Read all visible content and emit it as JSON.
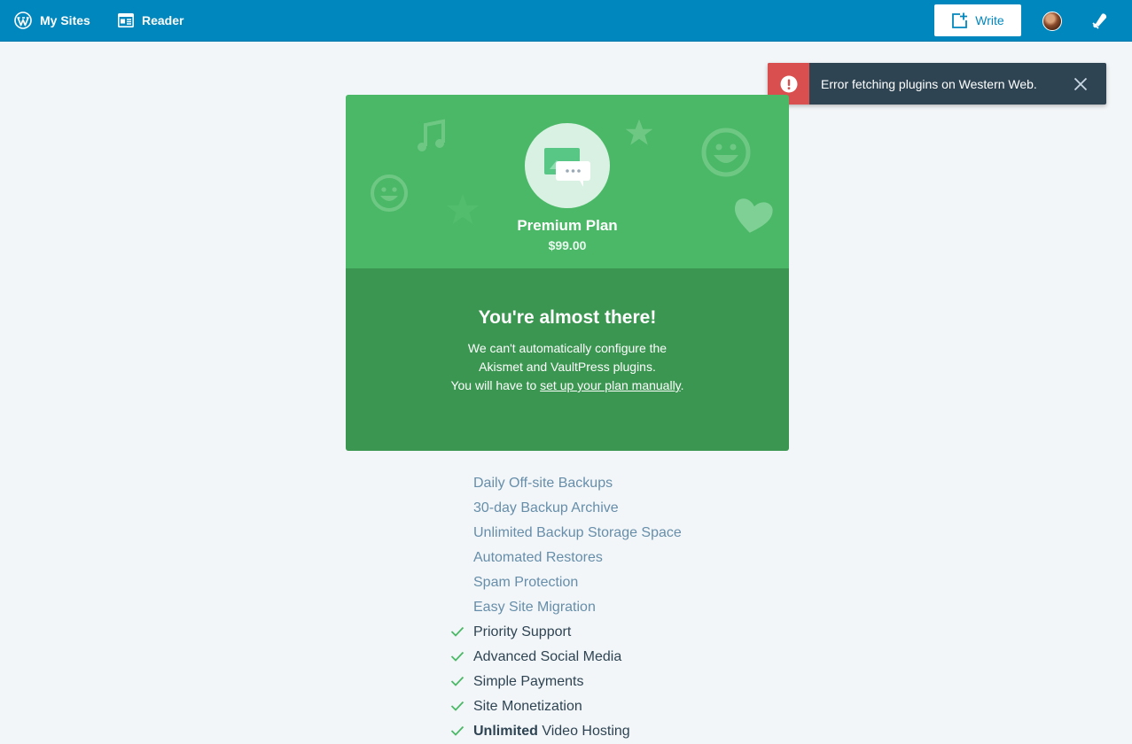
{
  "masterbar": {
    "my_sites": "My Sites",
    "reader": "Reader",
    "write": "Write"
  },
  "notice": {
    "status": "error",
    "text": "Error fetching plugins on Western Web.",
    "color": "#d94f4f"
  },
  "plan": {
    "name": "Premium Plan",
    "price": "$99.00",
    "accent": "#4ab866",
    "accent_dark": "#3a9650"
  },
  "message": {
    "title": "You're almost there!",
    "line1": "We can't automatically configure the",
    "line2": "Akismet and VaultPress plugins.",
    "line3_prefix": "You will have to ",
    "line3_link": "set up your plan manually",
    "line3_suffix": "."
  },
  "features": {
    "f1": "Daily Off-site Backups",
    "f2": "30-day Backup Archive",
    "f3": "Unlimited Backup Storage Space",
    "f4": "Automated Restores",
    "f5": "Spam Protection",
    "f6": "Easy Site Migration",
    "f7": "Priority Support",
    "f8": "Advanced Social Media",
    "f9": "Simple Payments",
    "f10": "Site Monetization",
    "f11_bold": "Unlimited",
    "f11_rest": " Video Hosting"
  }
}
